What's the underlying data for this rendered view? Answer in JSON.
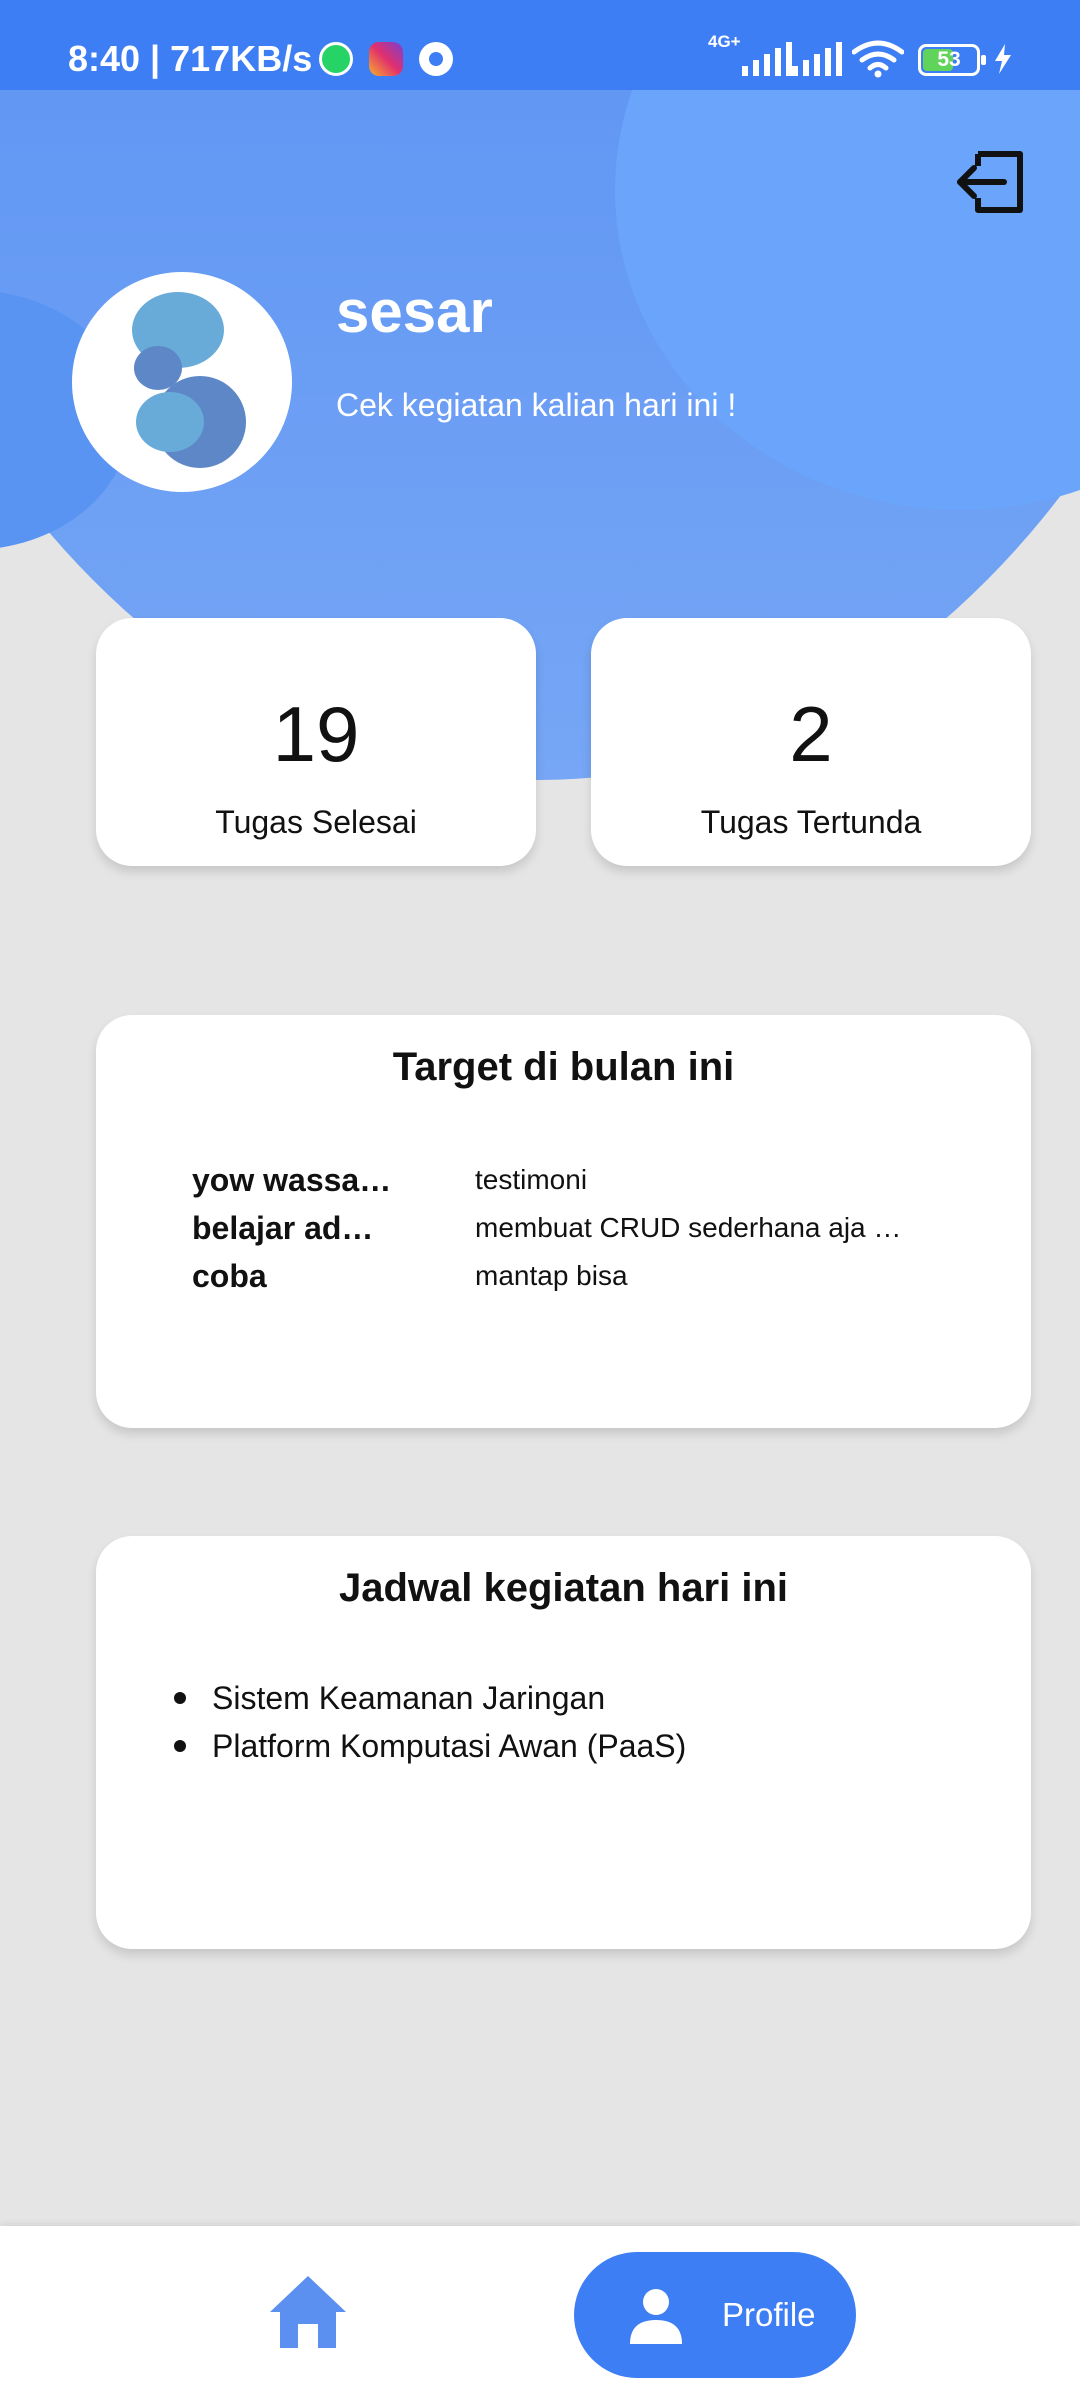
{
  "status_bar": {
    "time_speed": "8:40 | 717KB/s",
    "network_type": "4G+",
    "battery_level": "53",
    "battery_fraction": 0.53,
    "apps": [
      "whatsapp-icon",
      "instagram-icon",
      "settings-icon"
    ]
  },
  "profile": {
    "name": "sesar",
    "greeting": "Cek kegiatan kalian hari ini !"
  },
  "stats": {
    "done_count": "19",
    "done_label": "Tugas Selesai",
    "pending_count": "2",
    "pending_label": "Tugas Tertunda"
  },
  "targets": {
    "title": "Target di bulan ini",
    "items": [
      {
        "name": "yow wassalam",
        "desc": "testimoni"
      },
      {
        "name": "belajar adonis",
        "desc": "membuat CRUD sederhana aja gan"
      },
      {
        "name": "coba",
        "desc": "mantap bisa"
      }
    ]
  },
  "schedule": {
    "title": "Jadwal kegiatan hari ini",
    "items": [
      "Sistem Keamanan Jaringan",
      "Platform Komputasi Awan (PaaS)"
    ]
  },
  "bottom_nav": {
    "home_icon": "home-icon",
    "profile_label": "Profile"
  },
  "colors": {
    "primary": "#3e7ef4",
    "background": "#e5e5e5",
    "card": "#ffffff"
  }
}
